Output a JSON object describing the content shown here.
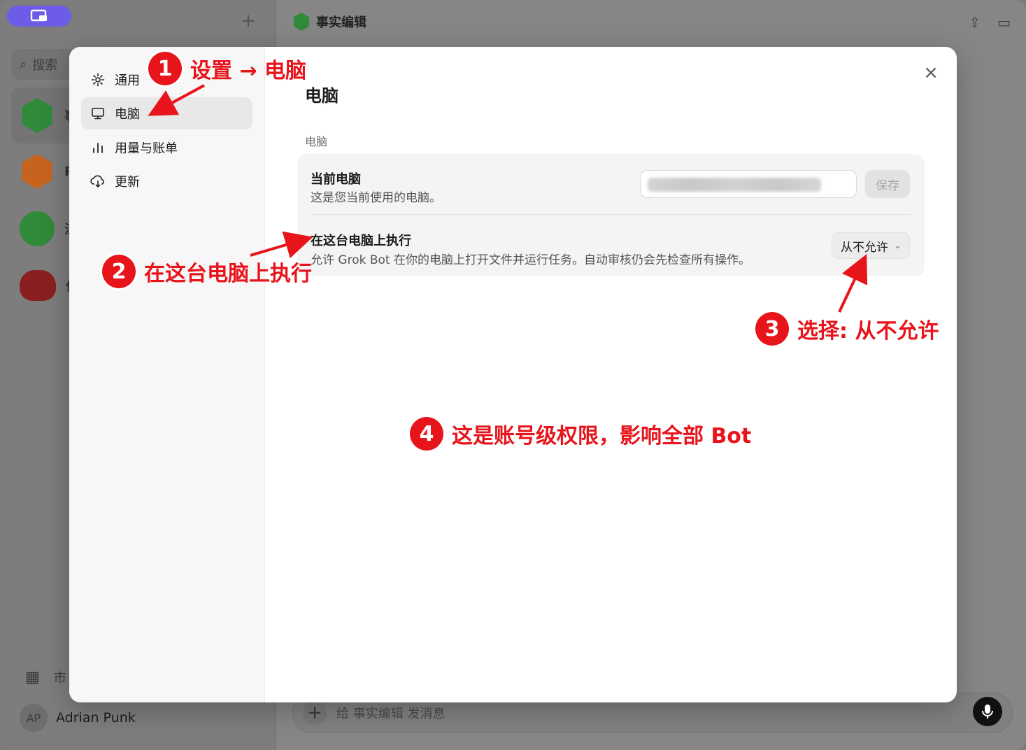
{
  "background": {
    "search_placeholder": "搜索",
    "chat_letters": [
      "事",
      "P",
      "泛",
      "价"
    ],
    "market_label": "市",
    "user_initials": "AP",
    "user_name": "Adrian Punk",
    "chat_title": "事实编辑",
    "composer_placeholder": "给 事实编辑 发消息"
  },
  "modal": {
    "nav": [
      {
        "label": "通用",
        "icon": "gear-icon"
      },
      {
        "label": "电脑",
        "icon": "monitor-icon"
      },
      {
        "label": "用量与账单",
        "icon": "bar-chart-icon"
      },
      {
        "label": "更新",
        "icon": "download-cloud-icon"
      }
    ],
    "title": "电脑",
    "section_label": "电脑",
    "current_computer": {
      "title": "当前电脑",
      "desc": "这是您当前使用的电脑。",
      "save_label": "保存"
    },
    "run_on_computer": {
      "title": "在这台电脑上执行",
      "desc": "允许 Grok Bot 在你的电脑上打开文件并运行任务。自动审核仍会先检查所有操作。",
      "selected_option": "从不允许"
    }
  },
  "annotations": [
    {
      "num": "1",
      "text": "设置 → 电脑"
    },
    {
      "num": "2",
      "text": "在这台电脑上执行"
    },
    {
      "num": "3",
      "text": "选择: 从不允许"
    },
    {
      "num": "4",
      "text": "这是账号级权限，影响全部 Bot"
    }
  ],
  "colors": {
    "annotation_red": "#e8141b",
    "brand_purple": "#6c5ce7",
    "bot_green": "#2f8a3a",
    "bot_orange": "#c8621f",
    "bot_red": "#8a1f1f"
  }
}
